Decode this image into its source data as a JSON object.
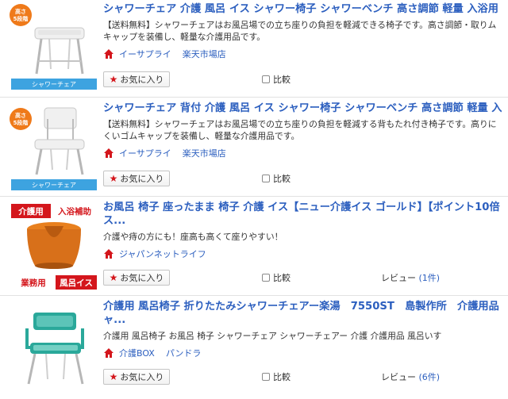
{
  "items": [
    {
      "title": "シャワーチェア 介護 風呂 イス シャワー椅子 シャワーベンチ 高さ調節 軽量 入浴用",
      "desc": "【送料無料】シャワーチェアはお風呂場での立ち座りの負担を軽減できる椅子です。高さ調節・取りムキャップを装備し、軽量な介護用品です。",
      "shop": "イーサプライ",
      "shop_sub": "楽天市場店",
      "thumb_badge": "高さ\n5段階",
      "thumb_caption": "シャワーチェア",
      "fav_label": "お気に入り",
      "compare_label": "比較"
    },
    {
      "title": "シャワーチェア 背付 介護 風呂 イス シャワー椅子 シャワーベンチ 高さ調節 軽量 入",
      "desc": "【送料無料】シャワーチェアはお風呂場での立ち座りの負担を軽減する背もたれ付き椅子です。高りにくいゴムキャップを装備し、軽量な介護用品です。",
      "shop": "イーサプライ",
      "shop_sub": "楽天市場店",
      "thumb_badge": "高さ\n5段階",
      "thumb_caption": "シャワーチェア",
      "fav_label": "お気に入り",
      "compare_label": "比較"
    },
    {
      "title": "お風呂 椅子 座ったまま 椅子 介護 イス【ニュー介護イス ゴールド】【ポイント10倍ス...",
      "desc": "介護や痔の方にも！座高も高くて座りやすい！",
      "shop": "ジャパンネットライフ",
      "shop_sub": "",
      "thumb_top_left": "介護用",
      "thumb_top_right": "入浴補助",
      "thumb_bottom_left": "業務用",
      "thumb_bottom_right": "風呂イス",
      "fav_label": "お気に入り",
      "compare_label": "比較",
      "review_label": "レビュー",
      "review_count": "(1件)"
    },
    {
      "title": "介護用 風呂椅子 折りたたみシャワーチェアー楽湯　7550ST　島製作所　介護用品 ャ...",
      "desc": "介護用 風呂椅子 お風呂 椅子 シャワーチェア シャワーチェアー 介護 介護用品 風呂いす",
      "shop": "介護BOX",
      "shop_sub": "パンドラ",
      "fav_label": "お気に入り",
      "compare_label": "比較",
      "review_label": "レビュー",
      "review_count": "(6件)"
    }
  ],
  "colors": {
    "link_blue": "#2c5fbf",
    "star_red": "#d4161c",
    "badge_orange": "#ef7a1a",
    "caption_blue": "#3da3e0",
    "seat_orange": "#e07616",
    "teal": "#2aa89a"
  },
  "icons": {
    "house": "house-icon",
    "star": "star-icon",
    "checkbox": "checkbox-icon"
  }
}
